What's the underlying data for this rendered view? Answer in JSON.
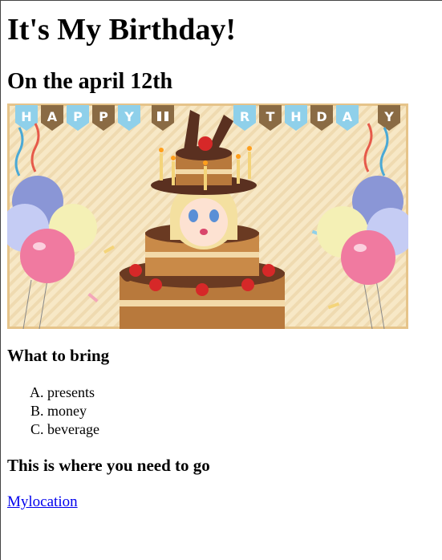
{
  "page": {
    "title": "It's My Birthday!",
    "date_heading": "On the april 12th",
    "bring_heading": "What to bring",
    "bring_items": [
      "presents",
      "money",
      "beverage"
    ],
    "go_heading": "This is where you need to go",
    "location_link": "Mylocation"
  },
  "banner": {
    "letters": [
      "H",
      "A",
      "P",
      "P",
      "Y",
      "B",
      "I",
      "R",
      "T",
      "H",
      "D",
      "A",
      "Y"
    ],
    "colors": {
      "bg": "#f7e8c6",
      "cake_dark": "#5a3020",
      "cake_mid": "#b8793c",
      "cream": "#f3d9a8",
      "cherry": "#d62828"
    }
  }
}
